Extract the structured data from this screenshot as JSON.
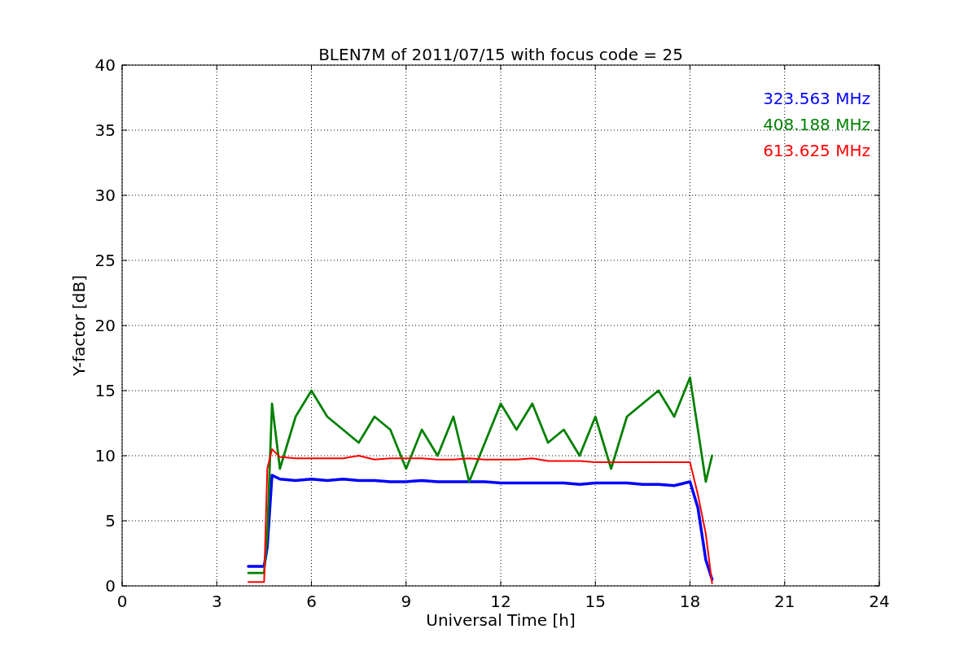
{
  "chart_data": {
    "type": "line",
    "title": "BLEN7M of 2011/07/15 with focus code = 25",
    "xlabel": "Universal Time [h]",
    "ylabel": "Y-factor [dB]",
    "x": [
      4,
      4.5,
      4.6,
      4.75,
      5,
      5.5,
      6,
      6.5,
      7,
      7.5,
      8,
      8.5,
      9,
      9.5,
      10,
      10.5,
      11,
      11.5,
      12,
      12.5,
      13,
      13.5,
      14,
      14.5,
      15,
      15.5,
      16,
      16.5,
      17,
      17.5,
      18,
      18.25,
      18.5,
      18.7
    ],
    "series": [
      {
        "name": "323.563 MHz",
        "color": "#0000ff",
        "values": [
          1.5,
          1.5,
          3,
          8.5,
          8.2,
          8.1,
          8.2,
          8.1,
          8.2,
          8.1,
          8.1,
          8.0,
          8.0,
          8.1,
          8.0,
          8.0,
          8.0,
          8.0,
          7.9,
          7.9,
          7.9,
          7.9,
          7.9,
          7.8,
          7.9,
          7.9,
          7.9,
          7.8,
          7.8,
          7.7,
          8.0,
          6,
          2,
          0.5
        ]
      },
      {
        "name": "408.188 MHz",
        "color": "#008000",
        "values": [
          1,
          1,
          4,
          14,
          9,
          13,
          15,
          13,
          12,
          11,
          13,
          12,
          9,
          12,
          10,
          13,
          8,
          11,
          14,
          12,
          14,
          11,
          12,
          10,
          13,
          9,
          13,
          14,
          15,
          13,
          16,
          12,
          8,
          10
        ]
      },
      {
        "name": "613.625 MHz",
        "color": "#ff0000",
        "values": [
          0.3,
          0.3,
          9,
          10.5,
          9.9,
          9.8,
          9.8,
          9.8,
          9.8,
          10,
          9.7,
          9.8,
          9.8,
          9.8,
          9.7,
          9.7,
          9.8,
          9.7,
          9.7,
          9.7,
          9.8,
          9.6,
          9.6,
          9.6,
          9.5,
          9.5,
          9.5,
          9.5,
          9.5,
          9.5,
          9.5,
          7,
          4,
          0.2
        ]
      }
    ],
    "xlim": [
      0,
      24
    ],
    "ylim": [
      0,
      40
    ],
    "xticks": [
      0,
      3,
      6,
      9,
      12,
      15,
      18,
      21,
      24
    ],
    "yticks": [
      0,
      5,
      10,
      15,
      20,
      25,
      30,
      35,
      40
    ],
    "grid": true
  }
}
